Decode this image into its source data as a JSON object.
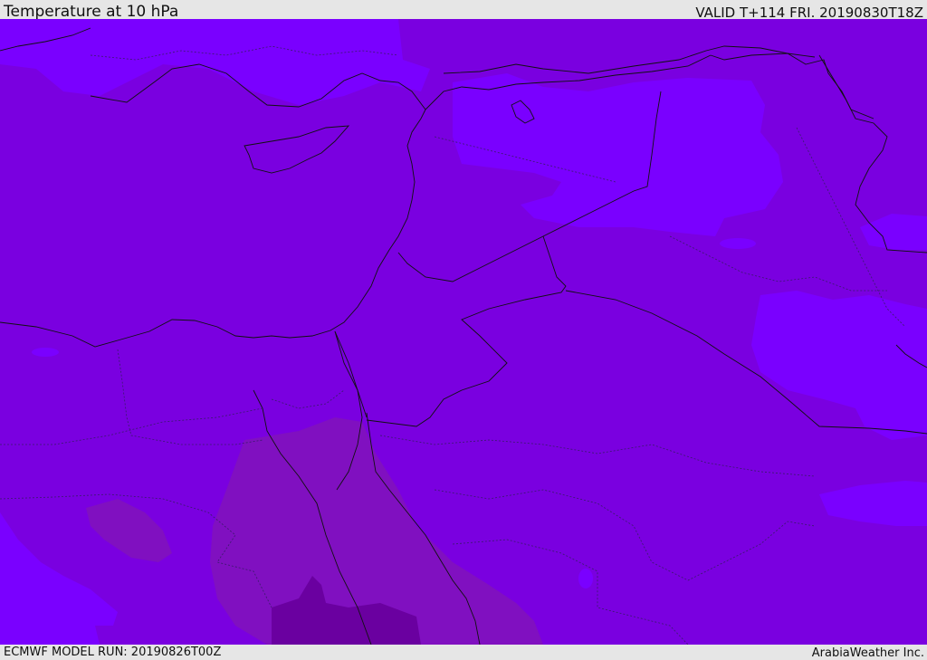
{
  "header": {
    "title": "Temperature at 10 hPa",
    "valid_time": "VALID T+114 FRI. 20190830T18Z"
  },
  "footer": {
    "model_run": "ECMWF MODEL RUN: 20190826T00Z",
    "credit": "ArabiaWeather Inc."
  },
  "map": {
    "colors": {
      "base_band": "#7a00e0",
      "cool_band": "#7a00ff",
      "warm_band": "#8010c0",
      "warmer_band": "#6a00a0",
      "lines": "#111111"
    }
  }
}
